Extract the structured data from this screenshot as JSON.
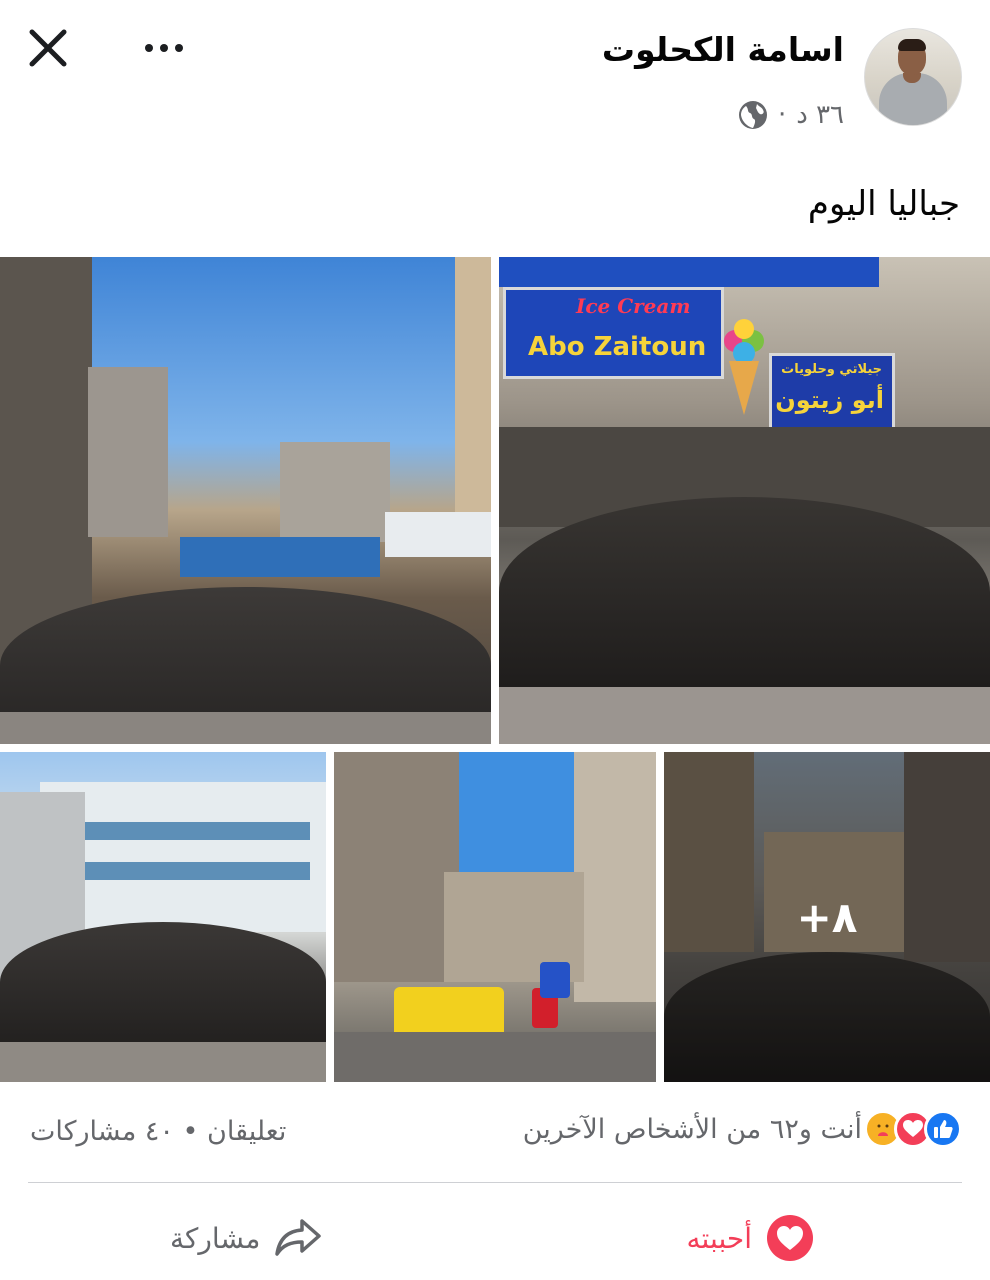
{
  "header": {
    "author_name": "اسامة الكحلوت",
    "timestamp": "٣٦ د",
    "separator": "·",
    "audience_icon": "globe-icon",
    "close_icon": "close-icon",
    "more_icon": "more-options-icon"
  },
  "post": {
    "text": "جباليا اليوم"
  },
  "photos": {
    "sign_line1": "Ice Cream",
    "sign_line2": "Abo Zaitoun",
    "sign_arabic_top": "جيلاتي وحلويات",
    "sign_arabic_main": "أبو زيتون",
    "more_count": "+٨"
  },
  "reactions": {
    "icons": [
      "like-icon",
      "love-icon",
      "care-icon"
    ],
    "text": "أنت و٦٢ من الأشخاص الآخرين"
  },
  "stats": {
    "text": "تعليقان • ٤٠ مشاركات"
  },
  "actions": {
    "like_label": "أحببته",
    "share_label": "مشاركة"
  },
  "colors": {
    "accent_blue": "#1877f2",
    "love_red": "#f33e58",
    "secondary_text": "#65676b"
  }
}
